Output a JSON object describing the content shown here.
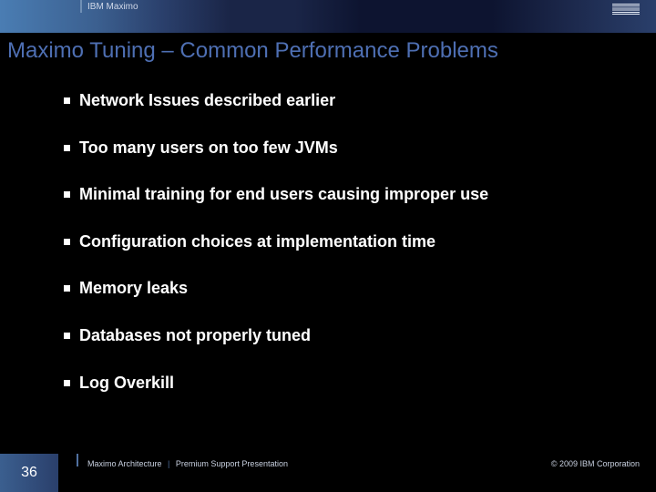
{
  "header": {
    "label": "IBM Maximo",
    "logo": "IBM"
  },
  "title": "Maximo Tuning – Common Performance Problems",
  "bullets": [
    "Network Issues described earlier",
    "Too many users on too few JVMs",
    "Minimal training for end users causing improper use",
    "Configuration choices at implementation time",
    "Memory leaks",
    "Databases not properly tuned",
    "Log Overkill"
  ],
  "footer": {
    "page_number": "36",
    "left_a": "Maximo Architecture",
    "left_b": "Premium Support Presentation",
    "right": "© 2009 IBM Corporation"
  }
}
